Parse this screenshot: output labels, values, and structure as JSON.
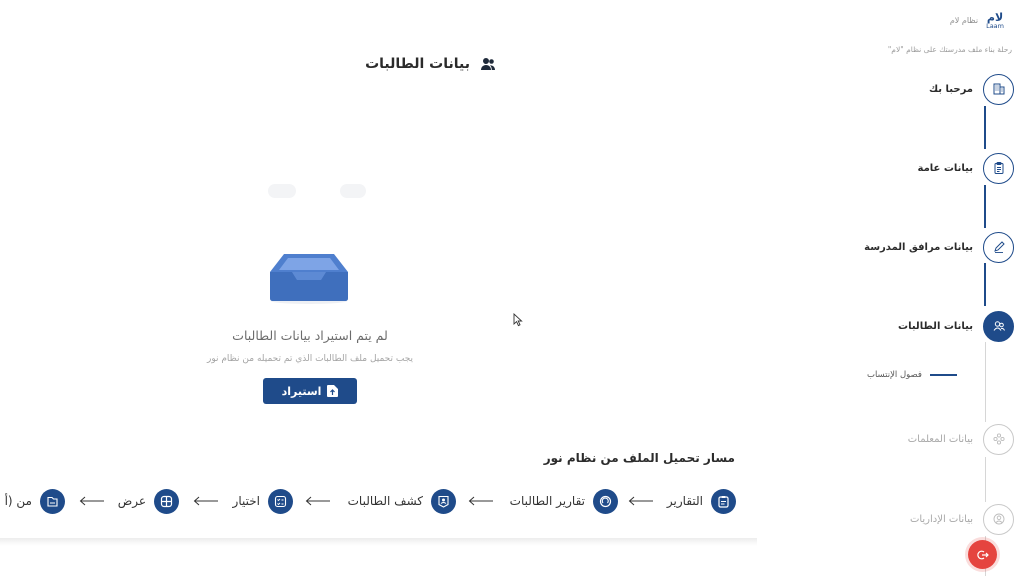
{
  "colors": {
    "primary": "#1f4b8a",
    "danger": "#e5443f",
    "muted": "#a9a9a9"
  },
  "header": {
    "title": "بيانات الطالبات",
    "icon": "users-icon"
  },
  "empty_state": {
    "title": "لم يتم استيراد بيانات الطالبات",
    "subtitle": "يجب تحميل ملف الطالبات الذي تم تحميله من نظام نور",
    "import_label": "استيراد",
    "icon": "inbox-tray-icon"
  },
  "upload_path": {
    "title": "مسار تحميل الملف من نظام نور",
    "steps": [
      {
        "label": "التقارير",
        "icon": "clipboard-icon"
      },
      {
        "label": "تقارير الطالبات",
        "icon": "badge-icon"
      },
      {
        "label": "كشف الطالبات",
        "icon": "id-badge-icon"
      },
      {
        "label": "اختيار",
        "icon": "checklist-icon"
      },
      {
        "label": "عرض",
        "icon": "grid-icon"
      },
      {
        "label": "من (أ",
        "icon": "file-icon"
      }
    ]
  },
  "sidebar": {
    "brand": "لام",
    "brand_latin": "Laam",
    "brand_sub": "نظام لام",
    "tagline": "رحلة بناء ملف مدرستك على نظام \"لام\"",
    "items": [
      {
        "label": "مرحبا بك",
        "icon": "building-icon",
        "state": "done"
      },
      {
        "label": "بيانات عامة",
        "icon": "clipboard-icon",
        "state": "done"
      },
      {
        "label": "بيانات مرافق المدرسة",
        "icon": "pencil-icon",
        "state": "done"
      },
      {
        "label": "بيانات الطالبات",
        "icon": "users-icon",
        "state": "active"
      },
      {
        "label": "بيانات المعلمات",
        "icon": "group-icon",
        "state": "disabled"
      },
      {
        "label": "بيانات الإداريات",
        "icon": "user-icon",
        "state": "disabled"
      }
    ],
    "sub_item": {
      "label": "فصول الإنتساب"
    },
    "logout_icon": "logout-icon"
  }
}
